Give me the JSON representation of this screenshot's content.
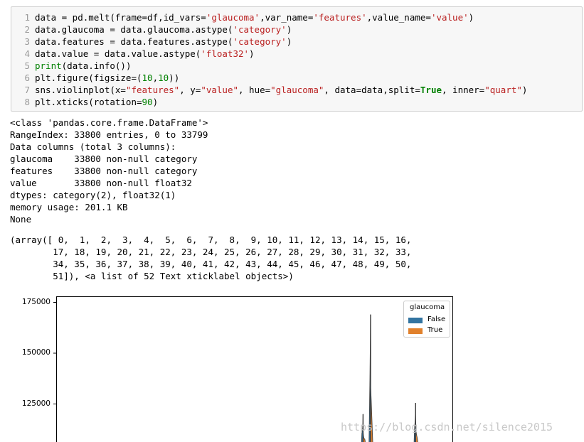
{
  "code_cell": {
    "lines": [
      {
        "n": "1",
        "t": "data = pd.melt(frame=df,id_vars='glaucoma',var_name='features',value_name='value')"
      },
      {
        "n": "2",
        "t": "data.glaucoma = data.glaucoma.astype('category')"
      },
      {
        "n": "3",
        "t": "data.features = data.features.astype('category')"
      },
      {
        "n": "4",
        "t": "data.value = data.value.astype('float32')"
      },
      {
        "n": "5",
        "t": "print(data.info())"
      },
      {
        "n": "6",
        "t": "plt.figure(figsize=(10,10))"
      },
      {
        "n": "7",
        "t": "sns.violinplot(x=\"features\", y=\"value\", hue=\"glaucoma\", data=data,split=True, inner=\"quart\")"
      },
      {
        "n": "8",
        "t": "plt.xticks(rotation=90)"
      }
    ]
  },
  "output": {
    "info_lines": [
      "<class 'pandas.core.frame.DataFrame'>",
      "RangeIndex: 33800 entries, 0 to 33799",
      "Data columns (total 3 columns):",
      "glaucoma    33800 non-null category",
      "features    33800 non-null category",
      "value       33800 non-null float32",
      "dtypes: category(2), float32(1)",
      "memory usage: 201.1 KB",
      "None"
    ],
    "array_lines": [
      "(array([ 0,  1,  2,  3,  4,  5,  6,  7,  8,  9, 10, 11, 12, 13, 14, 15, 16,",
      "        17, 18, 19, 20, 21, 22, 23, 24, 25, 26, 27, 28, 29, 30, 31, 32, 33,",
      "        34, 35, 36, 37, 38, 39, 40, 41, 42, 43, 44, 45, 46, 47, 48, 49, 50,",
      "        51]), <a list of 52 Text xticklabel objects>)"
    ]
  },
  "chart_data": {
    "type": "violin",
    "title": "",
    "xlabel": "",
    "ylabel": "",
    "y_ticks": [
      175000,
      150000,
      125000
    ],
    "y_tick_labels": [
      "175000",
      "150000",
      "125000"
    ],
    "visible_ylim": [
      105000,
      178000
    ],
    "legend": {
      "title": "glaucoma",
      "placement": "top-right",
      "entries": [
        {
          "label": "False",
          "color": "#3274a1"
        },
        {
          "label": "True",
          "color": "#e1812c"
        }
      ]
    },
    "visible_spikes": [
      {
        "feature_index": 40,
        "max": 120000
      },
      {
        "feature_index": 41,
        "max": 169000
      },
      {
        "feature_index": 47,
        "max": 125500
      }
    ]
  },
  "watermark": "https://blog.csdn.net/silence2015"
}
